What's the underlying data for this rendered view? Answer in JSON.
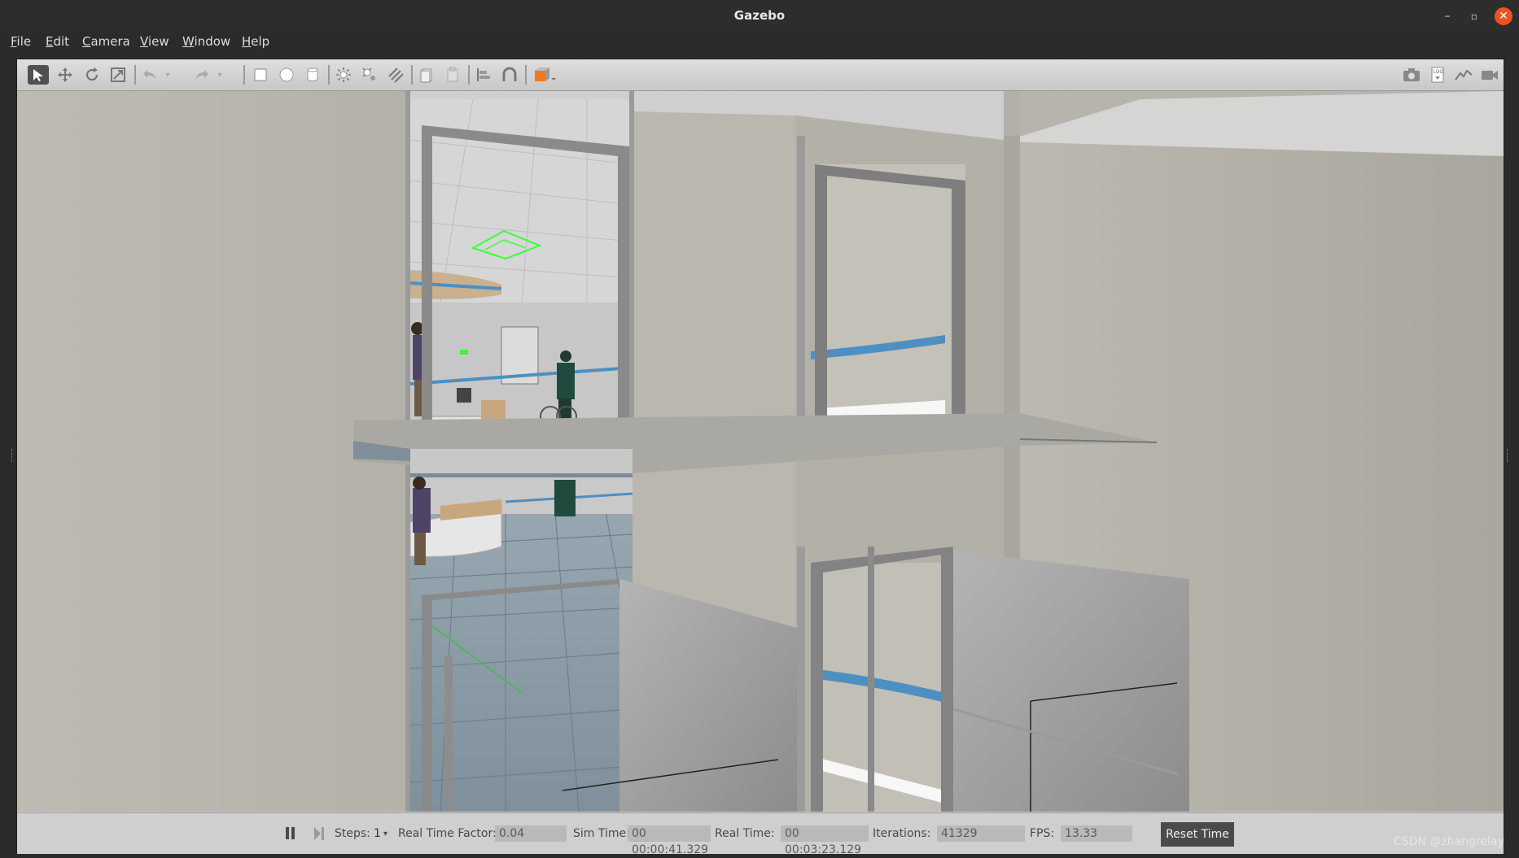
{
  "window": {
    "title": "Gazebo"
  },
  "window_controls": {
    "minimize": "–",
    "maximize": "▫",
    "close": "✕"
  },
  "menu": [
    "File",
    "Edit",
    "Camera",
    "View",
    "Window",
    "Help"
  ],
  "toolbar": {
    "left_icons": [
      "select-arrow-icon",
      "translate-icon",
      "rotate-icon",
      "scale-icon",
      "undo-icon",
      "undo-dropdown-icon",
      "redo-icon",
      "redo-dropdown-icon",
      "box-shape-icon",
      "sphere-shape-icon",
      "cylinder-shape-icon",
      "point-light-icon",
      "spot-light-icon",
      "directional-light-icon",
      "copy-icon",
      "paste-icon",
      "align-icon",
      "snap-icon",
      "view-angle-icon"
    ],
    "right_icons": [
      "screenshot-icon",
      "log-icon",
      "plot-icon",
      "video-record-icon"
    ]
  },
  "status": {
    "steps_label": "Steps:",
    "steps_value": "1",
    "rtf_label": "Real Time Factor:",
    "rtf_value": "0.04",
    "sim_time_label": "Sim Time:",
    "sim_time_value": "00 00:00:41.329",
    "real_time_label": "Real Time:",
    "real_time_value": "00 00:03:23.129",
    "iterations_label": "Iterations:",
    "iterations_value": "41329",
    "fps_label": "FPS:",
    "fps_value": "13.33",
    "reset_label": "Reset Time"
  },
  "watermark": "CSDN @zhangrelay",
  "colors": {
    "close_button": "#e95420",
    "viewport_wall": "#b9b6ae",
    "ceiling": "#d9d9d9",
    "floor": "#8fa0ab",
    "stripe": "#4d8fc0",
    "marker": "#3aff3a"
  }
}
